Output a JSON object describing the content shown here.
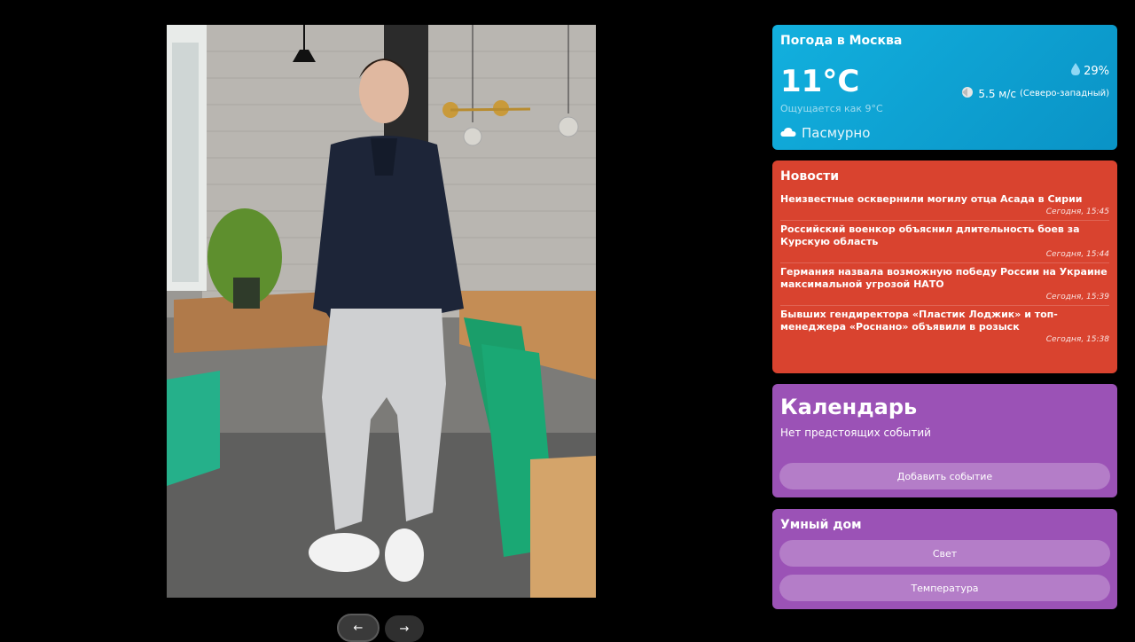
{
  "gallery": {
    "prev_label": "←",
    "next_label": "→"
  },
  "weather": {
    "title": "Погода в Москва",
    "temperature": "11°C",
    "feels_like": "Ощущается как 9°C",
    "condition": "Пасмурно",
    "humidity": "29%",
    "wind_speed": "5.5 м/с",
    "wind_direction": "(Северо-западный)",
    "icons": {
      "humidity": "droplet-icon",
      "wind": "wind-icon",
      "condition": "cloud-icon"
    }
  },
  "news": {
    "title": "Новости",
    "items": [
      {
        "headline": "Неизвестные осквернили могилу отца Асада в Сирии",
        "time": "Сегодня, 15:45"
      },
      {
        "headline": "Российский военкор объяснил длительность боев за Курскую область",
        "time": "Сегодня, 15:44"
      },
      {
        "headline": "Германия назвала возможную победу России на Украине максимальной угрозой НАТО",
        "time": "Сегодня, 15:39"
      },
      {
        "headline": "Бывших гендиректора «Пластик Лоджик» и топ-менеджера «Роснано» объявили в розыск",
        "time": "Сегодня, 15:38"
      }
    ]
  },
  "calendar": {
    "title": "Календарь",
    "empty_text": "Нет предстоящих событий",
    "add_button": "Добавить событие"
  },
  "smart_home": {
    "title": "Умный дом",
    "buttons": [
      "Свет",
      "Температура"
    ]
  },
  "colors": {
    "weather": "#0ea5d6",
    "news": "#d9432f",
    "calendar": "#9b52b6",
    "smart_home": "#9b52b6"
  }
}
